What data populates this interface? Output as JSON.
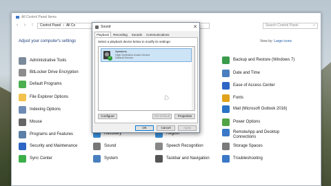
{
  "control_panel": {
    "title": "All Control Panel Items",
    "address": [
      "Control Panel",
      "All Co"
    ],
    "search_placeholder": "Search Control Panel",
    "subtitle": "Adjust your computer's settings",
    "view_by_label": "View by:",
    "view_by_value": "Large icons",
    "items": [
      {
        "label": "Administrative Tools",
        "color": "#7a8a9a"
      },
      {
        "label": "BitLocker Drive Encryption",
        "color": "#8c8c8c"
      },
      {
        "label": "Default Programs",
        "color": "#4caf50"
      },
      {
        "label": "File Explorer Options",
        "color": "#f2c14e"
      },
      {
        "label": "Indexing Options",
        "color": "#6e8bb5"
      },
      {
        "label": "Mouse",
        "color": "#666666"
      },
      {
        "label": "Programs and Features",
        "color": "#5b7fa6"
      },
      {
        "label": "Security and Maintenance",
        "color": "#2d66c4"
      },
      {
        "label": "Sync Center",
        "color": "#3cae4a"
      },
      {
        "label": "Recovery",
        "color": "#3a8fd8"
      },
      {
        "label": "Sound",
        "color": "#777777"
      },
      {
        "label": "System",
        "color": "#4a7fbf"
      },
      {
        "label": "Region",
        "color": "#3a8fd8"
      },
      {
        "label": "Speech Recognition",
        "color": "#888888"
      },
      {
        "label": "Taskbar and Navigation",
        "color": "#555555"
      },
      {
        "label": "Backup and Restore (Windows 7)",
        "color": "#3b9b4a"
      },
      {
        "label": "Date and Time",
        "color": "#4a7fbf"
      },
      {
        "label": "Ease of Access Center",
        "color": "#2d66c4"
      },
      {
        "label": "Fonts",
        "color": "#e0a21a"
      },
      {
        "label": "Mail (Microsoft Outlook 2016)",
        "color": "#2b73c4"
      },
      {
        "label": "Power Options",
        "color": "#52a344"
      },
      {
        "label": "RemoteApp and Desktop Connections",
        "color": "#3a78c7"
      },
      {
        "label": "Storage Spaces",
        "color": "#7a7a7a"
      },
      {
        "label": "Troubleshooting",
        "color": "#3a78c7"
      }
    ]
  },
  "sound_dialog": {
    "title": "Sound",
    "close": "✕",
    "tabs": [
      "Playback",
      "Recording",
      "Sounds",
      "Communications"
    ],
    "message": "Select a playback device below to modify its settings:",
    "device": {
      "name": "Speakers",
      "subtitle": "High Definition Audio Device",
      "status": "Default Device"
    },
    "buttons": {
      "configure": "Configure",
      "set_default": "Set Default",
      "properties": "Properties",
      "ok": "OK",
      "cancel": "Cancel",
      "apply": "Apply"
    }
  }
}
